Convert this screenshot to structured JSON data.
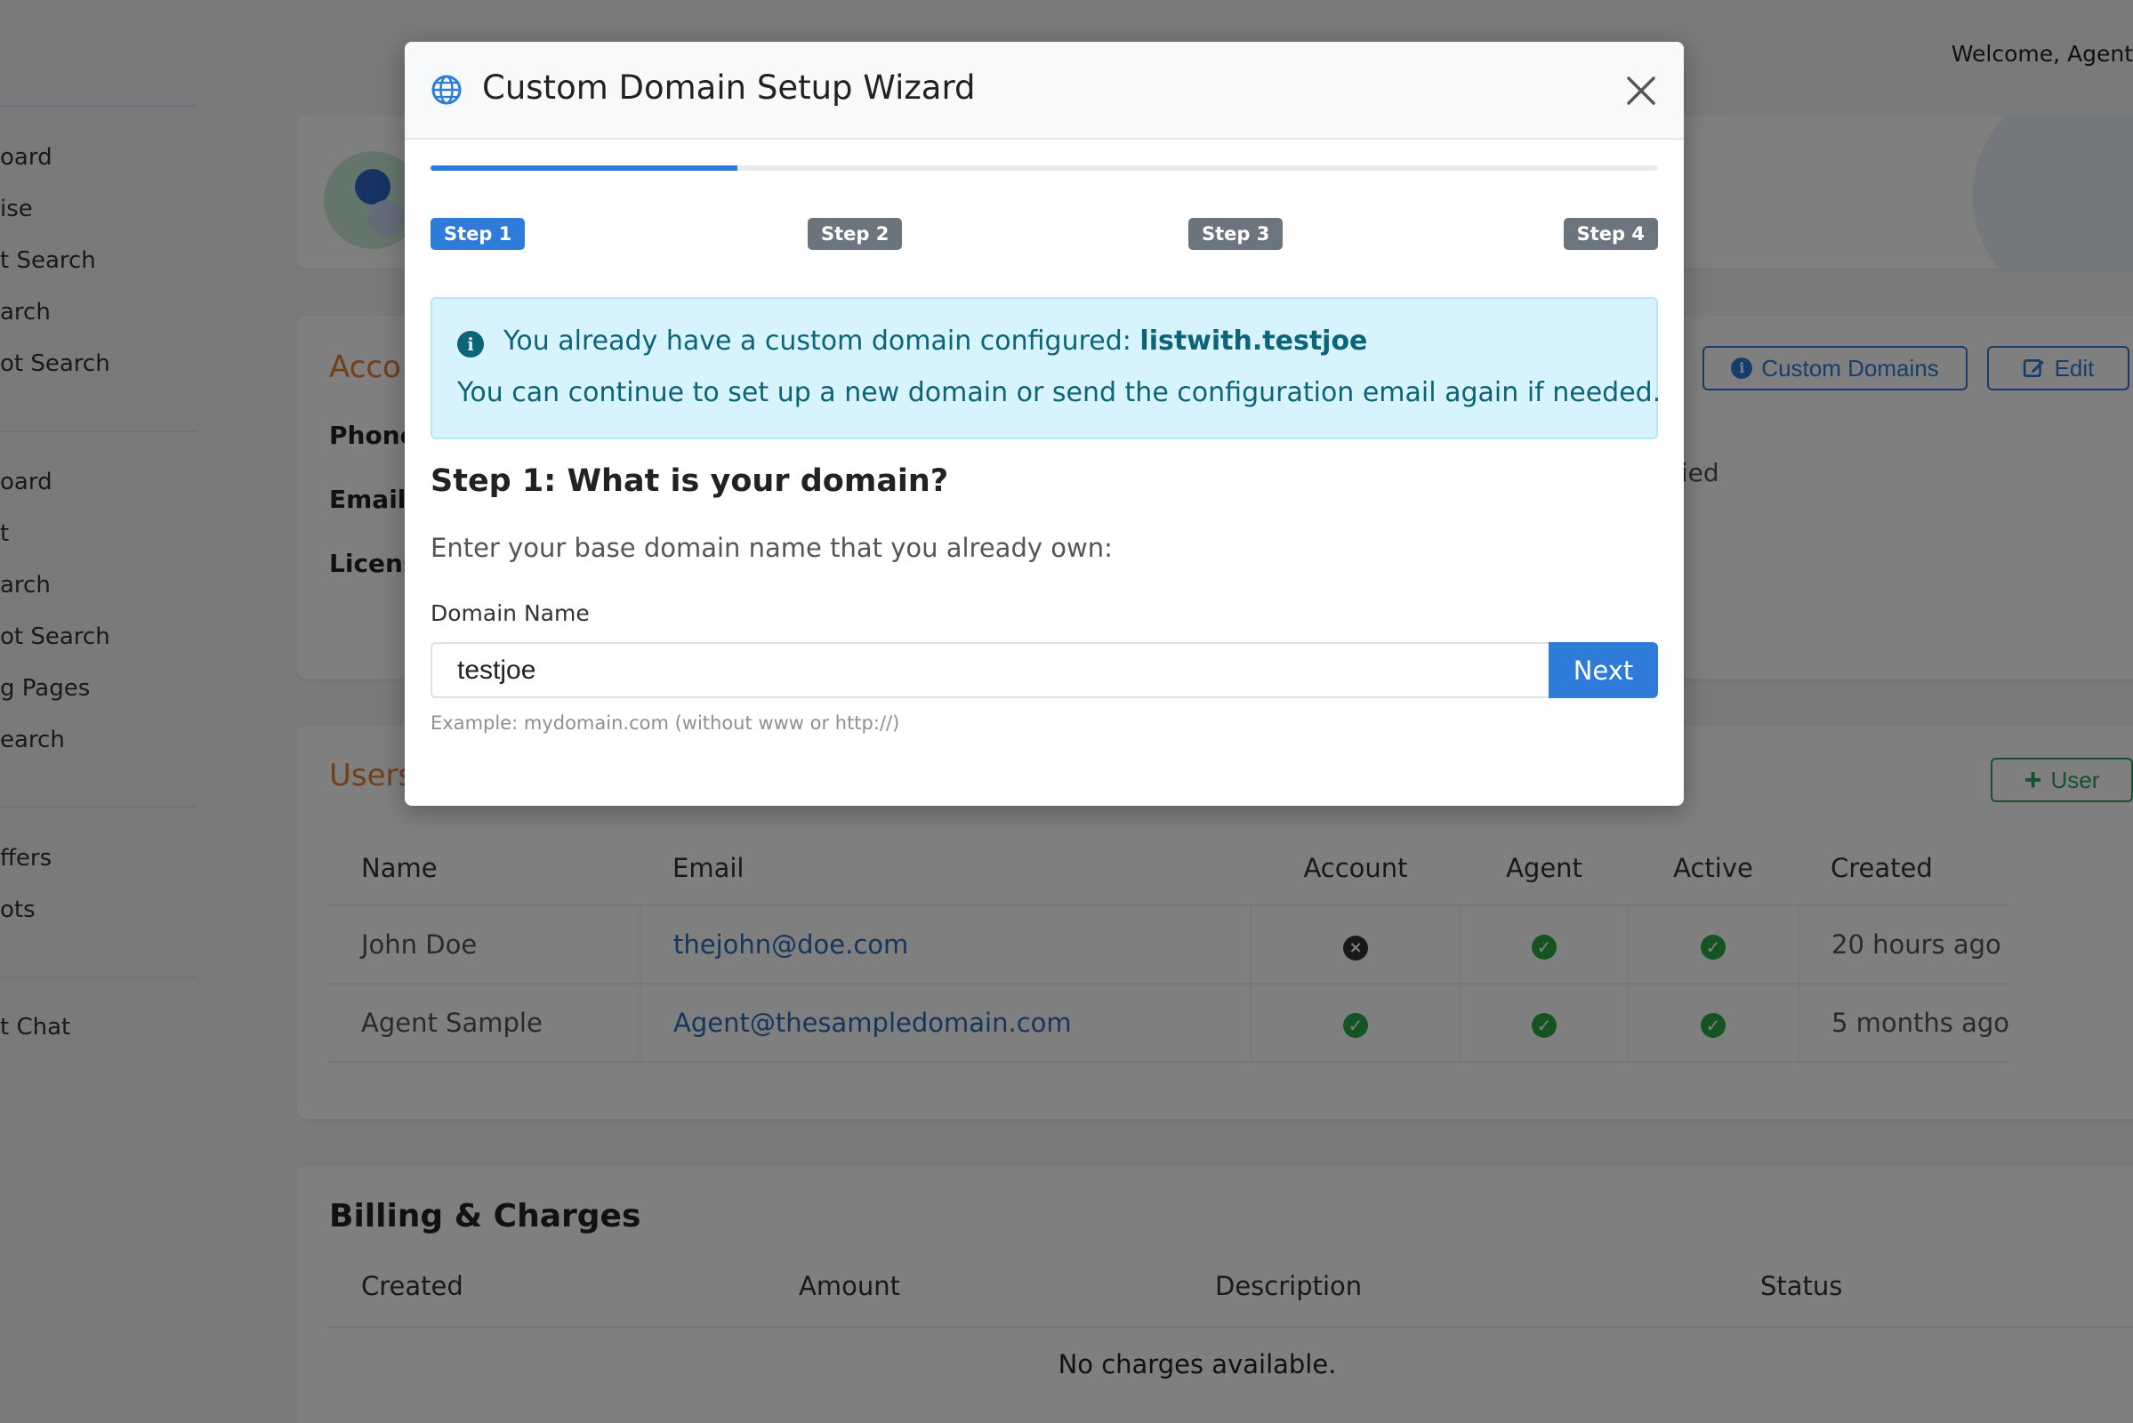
{
  "header": {
    "welcome": "Welcome, Agent"
  },
  "sidebar": {
    "items": [
      "oard",
      "ise",
      "t Search",
      "arch",
      "ot Search",
      "oard",
      "t",
      "arch",
      "ot Search",
      "g Pages",
      "earch",
      "ffers",
      "ots",
      "t Chat"
    ]
  },
  "account": {
    "title": "Acco",
    "labels": [
      "Phone",
      "Email:",
      "Licens"
    ],
    "verified_text": "fied",
    "custom_domains_label": "Custom Domains",
    "edit_label": "Edit"
  },
  "users": {
    "title": "Users",
    "add_user_label": "User",
    "columns": [
      "Name",
      "Email",
      "Account",
      "Agent",
      "Active",
      "Created"
    ],
    "rows": [
      {
        "name": "John Doe",
        "email": "thejohn@doe.com",
        "account": false,
        "agent": true,
        "active": true,
        "created": "20 hours ago"
      },
      {
        "name": "Agent Sample",
        "email": "Agent@thesampledomain.com",
        "account": true,
        "agent": true,
        "active": true,
        "created": "5 months ago"
      }
    ]
  },
  "billing": {
    "title": "Billing & Charges",
    "columns": [
      "Created",
      "Amount",
      "Description",
      "Status"
    ],
    "empty_text": "No charges available."
  },
  "modal": {
    "title": "Custom Domain Setup Wizard",
    "progress_fraction": 0.25,
    "steps": [
      "Step 1",
      "Step 2",
      "Step 3",
      "Step 4"
    ],
    "active_step": 0,
    "alert": {
      "prefix": "You already have a custom domain configured: ",
      "domain": "listwith.testjoe",
      "line2": "You can continue to set up a new domain or send the configuration email again if needed."
    },
    "step_heading": "Step 1: What is your domain?",
    "step_description": "Enter your base domain name that you already own:",
    "field_label": "Domain Name",
    "input_value": "testjoe",
    "next_label": "Next",
    "help_text": "Example: mydomain.com (without www or http://)"
  },
  "colors": {
    "primary": "#2f7bd9",
    "accent_orange": "#e67e35",
    "success": "#28a745",
    "info_bg": "#d7f3fb",
    "info_text": "#0c6478",
    "badge_inactive": "#6c757d"
  },
  "icons": {
    "modal": "globe-icon",
    "close": "close-icon",
    "alert": "info-circle-icon",
    "custom_domains": "info-circle-icon",
    "edit": "edit-icon",
    "add_user": "plus-icon",
    "status_true": "check-circle-icon",
    "status_false": "x-circle-icon"
  }
}
